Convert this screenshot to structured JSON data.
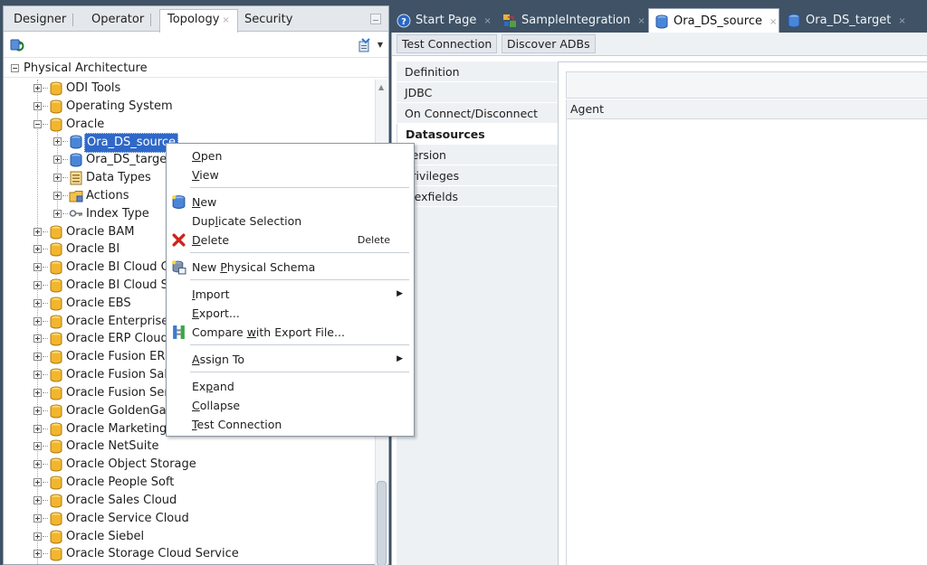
{
  "left_panel": {
    "tabs": [
      {
        "label": "Designer",
        "active": false
      },
      {
        "label": "Operator",
        "active": false
      },
      {
        "label": "Topology",
        "active": true,
        "close": "×"
      },
      {
        "label": "Security",
        "active": false
      }
    ],
    "tree_root": "Physical Architecture",
    "tree": [
      {
        "label": "ODI Tools",
        "level": 1,
        "toggle": "plus",
        "icon": "db-yellow"
      },
      {
        "label": "Operating System",
        "level": 1,
        "toggle": "plus",
        "icon": "db-yellow"
      },
      {
        "label": "Oracle",
        "level": 1,
        "toggle": "minus",
        "icon": "db-yellow"
      },
      {
        "label": "Ora_DS_source",
        "level": 2,
        "toggle": "plus",
        "icon": "db-blue",
        "selected": true
      },
      {
        "label": "Ora_DS_target",
        "level": 2,
        "toggle": "plus",
        "icon": "db-blue"
      },
      {
        "label": "Data Types",
        "level": 2,
        "toggle": "plus",
        "icon": "datatype"
      },
      {
        "label": "Actions",
        "level": 2,
        "toggle": "plus",
        "icon": "folder"
      },
      {
        "label": "Index Type",
        "level": 2,
        "toggle": "plus",
        "icon": "key"
      },
      {
        "label": "Oracle BAM",
        "level": 1,
        "toggle": "plus",
        "icon": "db-yellow"
      },
      {
        "label": "Oracle BI",
        "level": 1,
        "toggle": "plus",
        "icon": "db-yellow"
      },
      {
        "label": "Oracle BI Cloud Co",
        "level": 1,
        "toggle": "plus",
        "icon": "db-yellow"
      },
      {
        "label": "Oracle BI Cloud Se",
        "level": 1,
        "toggle": "plus",
        "icon": "db-yellow"
      },
      {
        "label": "Oracle EBS",
        "level": 1,
        "toggle": "plus",
        "icon": "db-yellow"
      },
      {
        "label": "Oracle Enterprise",
        "level": 1,
        "toggle": "plus",
        "icon": "db-yellow"
      },
      {
        "label": "Oracle ERP Cloud",
        "level": 1,
        "toggle": "plus",
        "icon": "db-yellow"
      },
      {
        "label": "Oracle Fusion ERP",
        "level": 1,
        "toggle": "plus",
        "icon": "db-yellow"
      },
      {
        "label": "Oracle Fusion Sale",
        "level": 1,
        "toggle": "plus",
        "icon": "db-yellow"
      },
      {
        "label": "Oracle Fusion Ser",
        "level": 1,
        "toggle": "plus",
        "icon": "db-yellow"
      },
      {
        "label": "Oracle GoldenGat",
        "level": 1,
        "toggle": "plus",
        "icon": "db-yellow"
      },
      {
        "label": "Oracle Marketing (",
        "level": 1,
        "toggle": "plus",
        "icon": "db-yellow"
      },
      {
        "label": "Oracle NetSuite",
        "level": 1,
        "toggle": "plus",
        "icon": "db-yellow"
      },
      {
        "label": "Oracle Object Storage",
        "level": 1,
        "toggle": "plus",
        "icon": "db-yellow"
      },
      {
        "label": "Oracle People Soft",
        "level": 1,
        "toggle": "plus",
        "icon": "db-yellow"
      },
      {
        "label": "Oracle Sales Cloud",
        "level": 1,
        "toggle": "plus",
        "icon": "db-yellow"
      },
      {
        "label": "Oracle Service Cloud",
        "level": 1,
        "toggle": "plus",
        "icon": "db-yellow"
      },
      {
        "label": "Oracle Siebel",
        "level": 1,
        "toggle": "plus",
        "icon": "db-yellow"
      },
      {
        "label": "Oracle Storage Cloud Service",
        "level": 1,
        "toggle": "plus",
        "icon": "db-yellow"
      }
    ]
  },
  "editor_tabs": [
    {
      "label": "Start Page",
      "icon": "help-icon",
      "active": false,
      "close": "×"
    },
    {
      "label": "SampleIntegration",
      "icon": "integration-icon",
      "active": false,
      "close": "×"
    },
    {
      "label": "Ora_DS_source",
      "icon": "db-blue",
      "active": true,
      "close": "×"
    },
    {
      "label": "Ora_DS_target",
      "icon": "db-blue",
      "active": false,
      "close": "×"
    }
  ],
  "toolbar": {
    "test_connection": "Test Connection",
    "discover_adbs": "Discover ADBs"
  },
  "nav": [
    {
      "label": "Definition",
      "active": false
    },
    {
      "label": "JDBC",
      "active": false
    },
    {
      "label": "On Connect/Disconnect",
      "active": false
    },
    {
      "label": "Datasources",
      "active": true
    },
    {
      "label": "Version",
      "active": false
    },
    {
      "label": "Privileges",
      "active": false
    },
    {
      "label": "Flexfields",
      "active": false
    }
  ],
  "datasources": {
    "column_agent": "Agent"
  },
  "context_menu": {
    "open": {
      "pre": "",
      "u": "O",
      "post": "pen"
    },
    "view": {
      "pre": "",
      "u": "V",
      "post": "iew"
    },
    "new": {
      "pre": "",
      "u": "N",
      "post": "ew"
    },
    "duplicate": {
      "pre": "Dup",
      "u": "l",
      "post": "icate Selection"
    },
    "delete": {
      "pre": "",
      "u": "D",
      "post": "elete",
      "shortcut": "Delete"
    },
    "new_schema": {
      "pre": "New ",
      "u": "P",
      "post": "hysical Schema"
    },
    "import": {
      "pre": "",
      "u": "I",
      "post": "mport"
    },
    "export": {
      "pre": "",
      "u": "E",
      "post": "xport..."
    },
    "compare": {
      "pre": "Compare ",
      "u": "w",
      "post": "ith Export File..."
    },
    "assign": {
      "pre": "",
      "u": "A",
      "post": "ssign To"
    },
    "expand": {
      "pre": "Ex",
      "u": "p",
      "post": "and"
    },
    "collapse": {
      "pre": "",
      "u": "C",
      "post": "ollapse"
    },
    "test": {
      "pre": "",
      "u": "T",
      "post": "est Connection"
    }
  },
  "colors": {
    "selection": "#2f68c8",
    "workspace": "#3f5266"
  }
}
